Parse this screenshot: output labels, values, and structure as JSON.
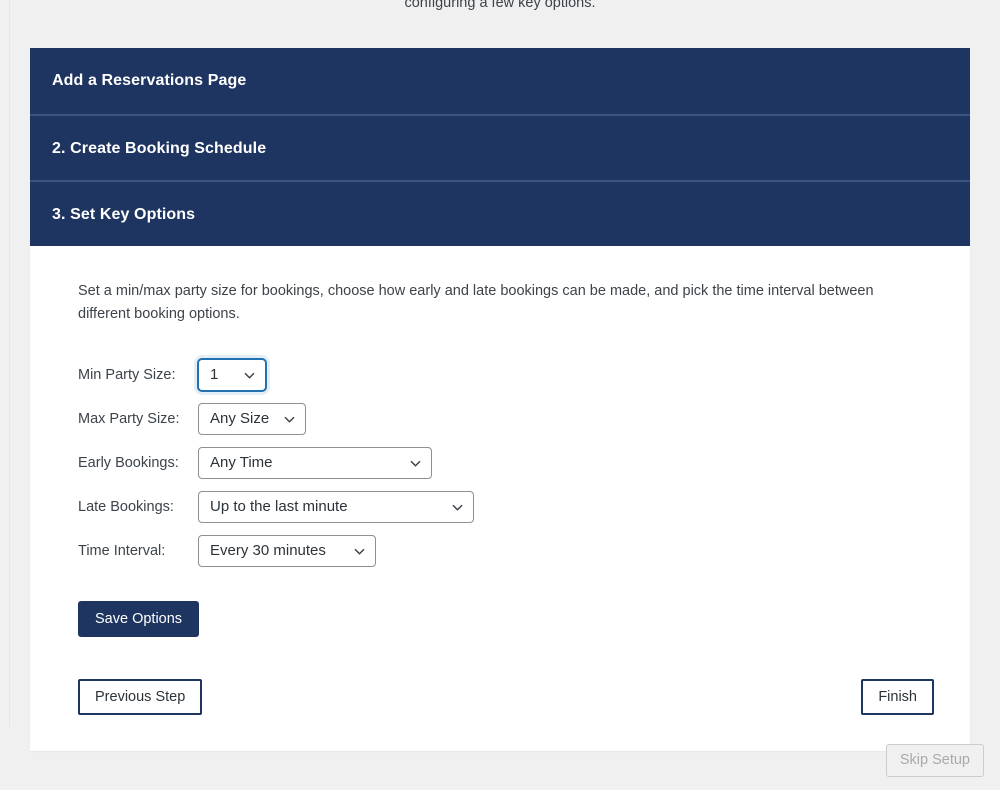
{
  "intro": {
    "truncated_text": "configuring a few key options."
  },
  "wizard": {
    "steps": [
      {
        "label": "Add a Reservations Page"
      },
      {
        "label": "2. Create Booking Schedule"
      },
      {
        "label": "3. Set Key Options"
      }
    ],
    "panel": {
      "description": "Set a min/max party size for bookings, choose how early and late bookings can be made, and pick the time interval between different booking options.",
      "fields": [
        {
          "label": "Min Party Size:",
          "value": "1",
          "focused": true,
          "icon": "chevron-down-icon"
        },
        {
          "label": "Max Party Size:",
          "value": "Any Size",
          "focused": false,
          "icon": "chevron-down-icon"
        },
        {
          "label": "Early Bookings:",
          "value": "Any Time",
          "focused": false,
          "icon": "chevron-down-icon"
        },
        {
          "label": "Late Bookings:",
          "value": "Up to the last minute",
          "focused": false,
          "icon": "chevron-down-icon"
        },
        {
          "label": "Time Interval:",
          "value": "Every 30 minutes",
          "focused": false,
          "icon": "chevron-down-icon"
        }
      ],
      "save_label": "Save Options",
      "previous_label": "Previous Step",
      "finish_label": "Finish"
    }
  },
  "footer": {
    "skip_label": "Skip Setup"
  },
  "colors": {
    "page_background": "#f0f0f1",
    "header_navy": "#1e3461",
    "header_divider": "#3c5483",
    "panel_background": "#ffffff",
    "text": "#3c434a",
    "focus_blue": "#2271b1",
    "select_border": "#8c8f94",
    "disabled_text": "#a7aaad"
  }
}
